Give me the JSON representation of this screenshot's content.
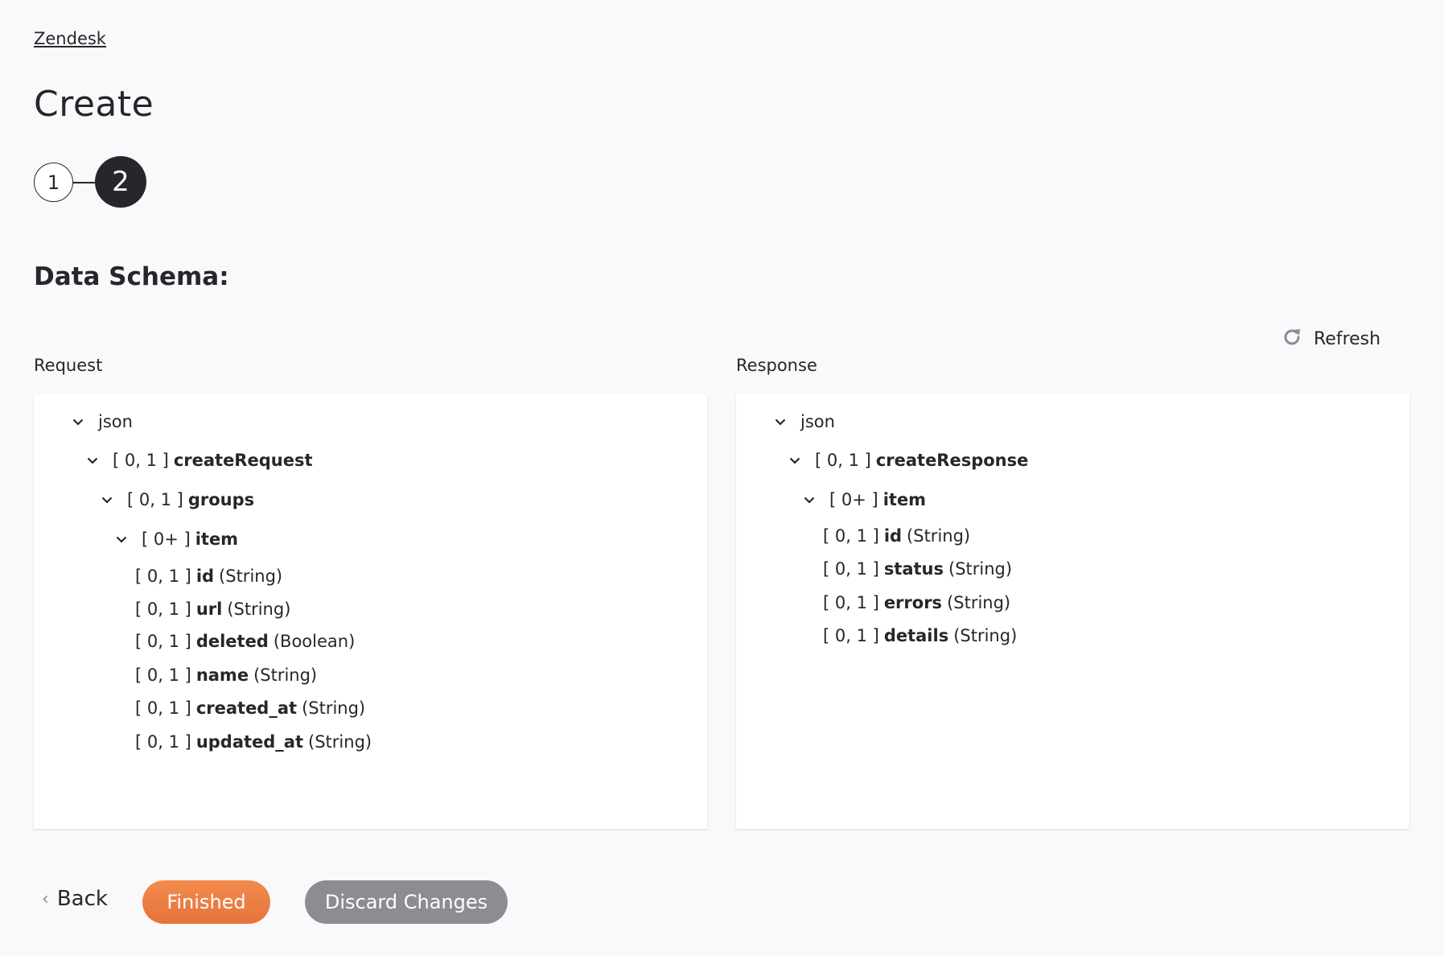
{
  "breadcrumb": {
    "label": "Zendesk"
  },
  "page": {
    "title": "Create"
  },
  "steps": [
    {
      "number": "1",
      "state": "complete"
    },
    {
      "number": "2",
      "state": "active"
    }
  ],
  "section": {
    "title": "Data Schema:"
  },
  "refresh": {
    "label": "Refresh",
    "icon": "refresh-icon"
  },
  "request": {
    "label": "Request",
    "tree": [
      {
        "depth": 0,
        "expandable": true,
        "cardinality": "",
        "name": "json",
        "type": "",
        "root": true
      },
      {
        "depth": 1,
        "expandable": true,
        "cardinality": "[ 0, 1 ]",
        "name": "createRequest",
        "type": ""
      },
      {
        "depth": 2,
        "expandable": true,
        "cardinality": "[ 0, 1 ]",
        "name": "groups",
        "type": ""
      },
      {
        "depth": 3,
        "expandable": true,
        "cardinality": "[ 0+ ]",
        "name": "item",
        "type": ""
      },
      {
        "depth": 4,
        "expandable": false,
        "cardinality": "[ 0, 1 ]",
        "name": "id",
        "type": "(String)"
      },
      {
        "depth": 4,
        "expandable": false,
        "cardinality": "[ 0, 1 ]",
        "name": "url",
        "type": "(String)"
      },
      {
        "depth": 4,
        "expandable": false,
        "cardinality": "[ 0, 1 ]",
        "name": "deleted",
        "type": "(Boolean)"
      },
      {
        "depth": 4,
        "expandable": false,
        "cardinality": "[ 0, 1 ]",
        "name": "name",
        "type": "(String)"
      },
      {
        "depth": 4,
        "expandable": false,
        "cardinality": "[ 0, 1 ]",
        "name": "created_at",
        "type": "(String)"
      },
      {
        "depth": 4,
        "expandable": false,
        "cardinality": "[ 0, 1 ]",
        "name": "updated_at",
        "type": "(String)"
      }
    ]
  },
  "response": {
    "label": "Response",
    "tree": [
      {
        "depth": 0,
        "expandable": true,
        "cardinality": "",
        "name": "json",
        "type": "",
        "root": true
      },
      {
        "depth": 1,
        "expandable": true,
        "cardinality": "[ 0, 1 ]",
        "name": "createResponse",
        "type": ""
      },
      {
        "depth": 2,
        "expandable": true,
        "cardinality": "[ 0+ ]",
        "name": "item",
        "type": ""
      },
      {
        "depth": 3,
        "expandable": false,
        "cardinality": "[ 0, 1 ]",
        "name": "id",
        "type": "(String)"
      },
      {
        "depth": 3,
        "expandable": false,
        "cardinality": "[ 0, 1 ]",
        "name": "status",
        "type": "(String)"
      },
      {
        "depth": 3,
        "expandable": false,
        "cardinality": "[ 0, 1 ]",
        "name": "errors",
        "type": "(String)"
      },
      {
        "depth": 3,
        "expandable": false,
        "cardinality": "[ 0, 1 ]",
        "name": "details",
        "type": "(String)"
      }
    ]
  },
  "footer": {
    "back_label": "Back",
    "finished_label": "Finished",
    "discard_label": "Discard Changes"
  },
  "colors": {
    "accent": "#ee7f44",
    "secondary": "#8e8b92",
    "text": "#27262b",
    "background": "#f9f9fb"
  }
}
